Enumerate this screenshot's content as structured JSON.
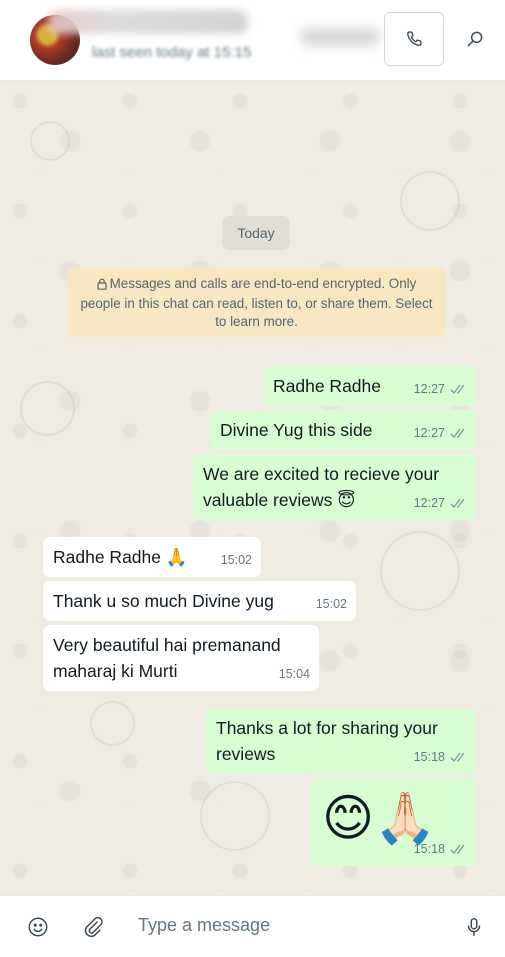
{
  "header": {
    "contact_name": "Contact name",
    "last_seen": "last seen today at 15:15"
  },
  "chat": {
    "date_chip": "Today",
    "encryption_notice": "Messages and calls are end-to-end encrypted. Only people in this chat can read, listen to, or share them. Select to learn more.",
    "messages": [
      {
        "dir": "out",
        "text": "Radhe Radhe",
        "time": "12:27"
      },
      {
        "dir": "out",
        "text": "Divine Yug this side",
        "time": "12:27"
      },
      {
        "dir": "out",
        "text": "We are excited to recieve your valuable reviews 😇",
        "time": "12:27"
      },
      {
        "dir": "in",
        "text": "Radhe Radhe 🙏",
        "time": "15:02"
      },
      {
        "dir": "in",
        "text": "Thank u so much Divine yug",
        "time": "15:02"
      },
      {
        "dir": "in",
        "text": "Very beautiful hai premanand maharaj ki Murti",
        "time": "15:04"
      },
      {
        "dir": "out",
        "text": "Thanks a lot for sharing your reviews",
        "time": "15:18"
      },
      {
        "dir": "out",
        "text": "😊🙏🏻",
        "time": "15:18"
      }
    ]
  },
  "input": {
    "placeholder": "Type a message"
  },
  "icons": {
    "call": "phone-icon",
    "search": "search-icon",
    "emoji": "emoji-icon",
    "attach": "paperclip-icon",
    "mic": "microphone-icon",
    "lock": "lock-icon",
    "read_receipt": "double-check-icon"
  },
  "colors": {
    "outgoing_bubble": "#d9fdd3",
    "incoming_bubble": "#ffffff",
    "encryption_notice_bg": "#f9e7c1",
    "chat_bg": "#efeae2"
  }
}
